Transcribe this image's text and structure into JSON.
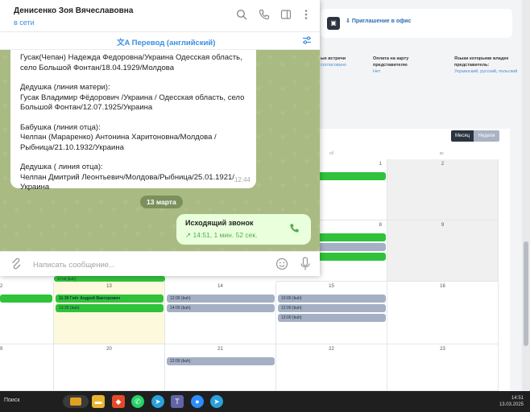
{
  "telegram": {
    "contact_name": "Денисенко Зоя Вячеславовна",
    "status": "в сети",
    "translate_bar": "Перевод (английский)",
    "message_paragraphs": [
      "Гусак(Чепан) Надежда Федоровна/Украина Одесская область, село Большой Фонтан/18.04.1929/Молдова",
      "Дедушка (линия матери):\nГусак Владимир Фёдорович /Украина / Одесская область, село Большой Фонтан/12.07.1925/Украина",
      "Бабушка (линия отца):\nЧелпан (Мараренко) Антонина Харитоновна/Молдова /Рыбница/21.10.1932/Украина",
      "Дедушка ( линия отца):\nЧелпан Дмитрий Леонтьевич/Молдова/Рыбница/25.01.1921/Украина"
    ],
    "message_time": "12:44",
    "date_separator": "13 марта",
    "call_title": "Исходящий звонок",
    "call_detail": "14:51, 1 мин. 52 сек.",
    "input_placeholder": "Написать сообщение..."
  },
  "crm": {
    "invite_label": "Приглашение в офис",
    "info": [
      {
        "label": "ые встречи",
        "value": "согласовано"
      },
      {
        "label": "Оплата на карту представителю",
        "value": "Нет"
      },
      {
        "label": "Языки которыми владее представитель:",
        "value": "Украинский, русский, польский"
      }
    ],
    "view_month": "Месяц",
    "view_week": "Неделя",
    "weekdays": [
      "сб",
      "вс"
    ],
    "week2_days": [
      "1",
      "2"
    ],
    "week3_days": [
      "8",
      "9"
    ],
    "week4_days": [
      "2",
      "13",
      "14",
      "15",
      "16"
    ],
    "week5_days": [
      "9",
      "20",
      "21",
      "22",
      "23"
    ],
    "events": {
      "e1": "17:00 (buh)",
      "e2": "11:30 Гнёт Андрей Викторович",
      "e3": "13:30 (buh)",
      "e4": "12:00 (buh)",
      "e5": "14:00 (buh)",
      "e6": "10:00 (buh)",
      "e7": "12:00 (buh)",
      "e8": "13:00 (buh)",
      "e9": "12:00 (buh)"
    }
  },
  "taskbar": {
    "search_label": "Поиск",
    "time": "14:51",
    "date": "13.03.2025"
  },
  "colors": {
    "accent_blue": "#3a8ee0",
    "event_green": "#2fc23a",
    "event_gray": "#a5b0c4",
    "chat_bg": "#a9bb83",
    "outgoing_bubble": "#eaffdc"
  }
}
